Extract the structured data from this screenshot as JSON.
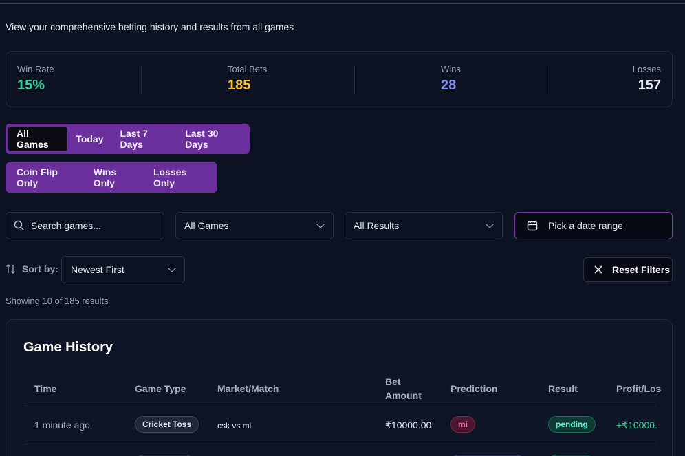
{
  "subtitle": "View your comprehensive betting history and results from all games",
  "stats": {
    "win_rate": {
      "label": "Win Rate",
      "value": "15%",
      "color": "#34d399"
    },
    "total_bets": {
      "label": "Total Bets",
      "value": "185",
      "color": "#fbbf24"
    },
    "wins": {
      "label": "Wins",
      "value": "28",
      "color": "#818cf8"
    },
    "losses": {
      "label": "Losses",
      "value": "157",
      "color": "#e6e9f0"
    }
  },
  "time_tabs": [
    "All Games",
    "Today",
    "Last 7 Days",
    "Last 30 Days"
  ],
  "filter_tabs": [
    "Coin Flip Only",
    "Wins Only",
    "Losses Only"
  ],
  "search": {
    "placeholder": "Search games...",
    "icon": "search-icon"
  },
  "game_select": {
    "value": "All Games"
  },
  "result_select": {
    "value": "All Results"
  },
  "date_range": {
    "label": "Pick a date range",
    "icon": "calendar-icon"
  },
  "sort": {
    "label": "Sort by:",
    "value": "Newest First",
    "icon": "sort-arrows-icon"
  },
  "reset": {
    "label": "Reset Filters",
    "icon": "close-icon"
  },
  "showing": "Showing 10 of 185 results",
  "history": {
    "title": "Game History",
    "columns": {
      "time": "Time",
      "game_type": "Game Type",
      "market": "Market/Match",
      "bet_amount_1": "Bet",
      "bet_amount_2": "Amount",
      "prediction": "Prediction",
      "result": "Result",
      "profit": "Profit/Los"
    },
    "rows": [
      {
        "time": "1 minute ago",
        "game_type": "Cricket Toss",
        "market": "csk vs mi",
        "bet_amount": "₹10000.00",
        "prediction": "mi",
        "result": "pending",
        "profit": "+₹10000."
      }
    ]
  },
  "accent": "#6b2f9e"
}
